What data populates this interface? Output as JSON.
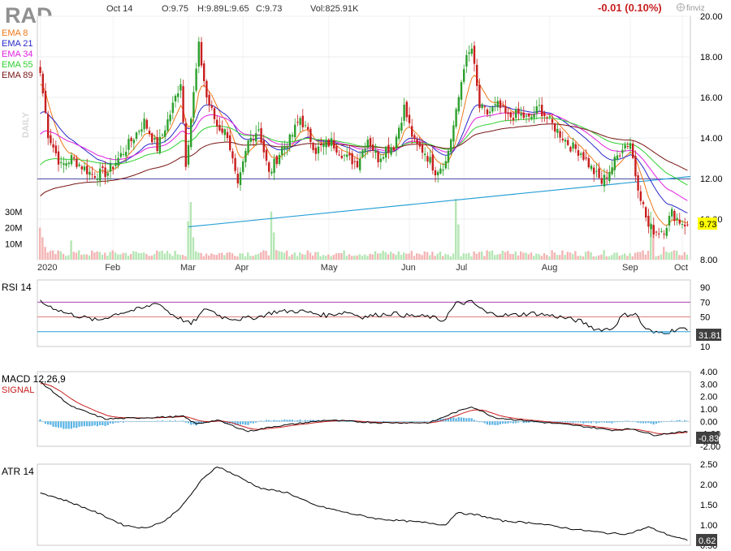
{
  "header": {
    "ticker": "RAD",
    "date": "Oct 14",
    "open": "O:9.75",
    "high": "H:9.89",
    "low": "L:9.65",
    "close": "C:9.73",
    "volume": "Vol:825.91K",
    "change": "-0.01 (0.10%)",
    "brand": "finviz",
    "brand_icon": "globe-icon",
    "period": "DAILY"
  },
  "colors": {
    "up": "#2ca02c",
    "down": "#c81e1e",
    "ema8": "#f07818",
    "ema21": "#2828c8",
    "ema34": "#e020e0",
    "ema55": "#30d030",
    "ema89": "#781414",
    "rsi": "#000000",
    "macd": "#000000",
    "signal": "#c81e1e",
    "hist": "#5ab4e6",
    "trend": "#2a9fd6",
    "hline": "#5050aa",
    "price_tag": "#ffff00"
  },
  "chart_data": [
    {
      "type": "candlestick",
      "title": "RAD",
      "x_ticks": [
        "2020",
        "Feb",
        "Mar",
        "Apr",
        "May",
        "Jun",
        "Jul",
        "Aug",
        "Sep",
        "Oct"
      ],
      "ylim": [
        8,
        20
      ],
      "y_ticks": [
        "8.00",
        "10.00",
        "12.00",
        "14.00",
        "16.00",
        "18.00",
        "20.00"
      ],
      "last_price": "9.73",
      "legend": [
        {
          "key": "ema8",
          "label": "EMA 8"
        },
        {
          "key": "ema21",
          "label": "EMA 21"
        },
        {
          "key": "ema34",
          "label": "EMA 34"
        },
        {
          "key": "ema55",
          "label": "EMA 55"
        },
        {
          "key": "ema89",
          "label": "EMA 89"
        }
      ],
      "volume_ticks": [
        "10M",
        "20M",
        "30M"
      ],
      "volume_max_m": 38,
      "horizontal_line": 11.98,
      "trend_line": {
        "from": [
          "Mar",
          9.62
        ],
        "to": [
          "Oct",
          12.1
        ]
      },
      "close_anchors": [
        {
          "i": 0,
          "v": 17.2
        },
        {
          "i": 3,
          "v": 14.2
        },
        {
          "i": 8,
          "v": 12.6
        },
        {
          "i": 12,
          "v": 13.0
        },
        {
          "i": 20,
          "v": 12.2
        },
        {
          "i": 26,
          "v": 12.3
        },
        {
          "i": 33,
          "v": 13.5
        },
        {
          "i": 40,
          "v": 14.8
        },
        {
          "i": 45,
          "v": 13.5
        },
        {
          "i": 50,
          "v": 15.2
        },
        {
          "i": 54,
          "v": 16.8
        },
        {
          "i": 56,
          "v": 12.8
        },
        {
          "i": 58,
          "v": 15.0
        },
        {
          "i": 61,
          "v": 18.5
        },
        {
          "i": 64,
          "v": 16.0
        },
        {
          "i": 68,
          "v": 14.6
        },
        {
          "i": 72,
          "v": 14.2
        },
        {
          "i": 76,
          "v": 11.5
        },
        {
          "i": 80,
          "v": 13.8
        },
        {
          "i": 84,
          "v": 14.5
        },
        {
          "i": 88,
          "v": 12.2
        },
        {
          "i": 93,
          "v": 13.5
        },
        {
          "i": 96,
          "v": 13.9
        },
        {
          "i": 100,
          "v": 15.0
        },
        {
          "i": 106,
          "v": 13.4
        },
        {
          "i": 112,
          "v": 13.8
        },
        {
          "i": 118,
          "v": 13.0
        },
        {
          "i": 122,
          "v": 12.8
        },
        {
          "i": 126,
          "v": 14.0
        },
        {
          "i": 130,
          "v": 13.0
        },
        {
          "i": 133,
          "v": 13.5
        },
        {
          "i": 136,
          "v": 13.6
        },
        {
          "i": 140,
          "v": 15.5
        },
        {
          "i": 144,
          "v": 13.7
        },
        {
          "i": 148,
          "v": 13.3
        },
        {
          "i": 152,
          "v": 12.4
        },
        {
          "i": 156,
          "v": 12.8
        },
        {
          "i": 160,
          "v": 15.2
        },
        {
          "i": 163,
          "v": 17.6
        },
        {
          "i": 166,
          "v": 18.4
        },
        {
          "i": 169,
          "v": 15.5
        },
        {
          "i": 172,
          "v": 15.2
        },
        {
          "i": 176,
          "v": 15.6
        },
        {
          "i": 180,
          "v": 15.0
        },
        {
          "i": 184,
          "v": 15.2
        },
        {
          "i": 188,
          "v": 14.9
        },
        {
          "i": 192,
          "v": 15.5
        },
        {
          "i": 196,
          "v": 14.8
        },
        {
          "i": 200,
          "v": 14.2
        },
        {
          "i": 204,
          "v": 13.6
        },
        {
          "i": 208,
          "v": 13.3
        },
        {
          "i": 212,
          "v": 12.5
        },
        {
          "i": 216,
          "v": 11.8
        },
        {
          "i": 220,
          "v": 12.6
        },
        {
          "i": 224,
          "v": 13.6
        },
        {
          "i": 227,
          "v": 13.8
        },
        {
          "i": 229,
          "v": 12.2
        },
        {
          "i": 232,
          "v": 10.6
        },
        {
          "i": 234,
          "v": 9.6
        },
        {
          "i": 237,
          "v": 9.4
        },
        {
          "i": 240,
          "v": 9.5
        },
        {
          "i": 243,
          "v": 10.3
        },
        {
          "i": 246,
          "v": 9.9
        },
        {
          "i": 249,
          "v": 9.73
        }
      ]
    },
    {
      "type": "line",
      "title": "RSI 14",
      "ylim": [
        10,
        100
      ],
      "y_ticks": [
        "10",
        "30",
        "50",
        "70",
        "90"
      ],
      "ref_lines": [
        30,
        50,
        70
      ],
      "last_value": "31.81"
    },
    {
      "type": "line",
      "title": "MACD 12,26,9",
      "signal_label": "SIGNAL",
      "ylim": [
        -2,
        4
      ],
      "y_ticks": [
        "-2.00",
        "-1.00",
        "0.00",
        "1.00",
        "2.00",
        "3.00",
        "4.00"
      ],
      "last_value": "-0.83"
    },
    {
      "type": "line",
      "title": "ATR 14",
      "ylim": [
        0.5,
        2.5
      ],
      "y_ticks": [
        "0.50",
        "1.00",
        "1.50",
        "2.00",
        "2.50"
      ],
      "last_value": "0.62"
    }
  ]
}
